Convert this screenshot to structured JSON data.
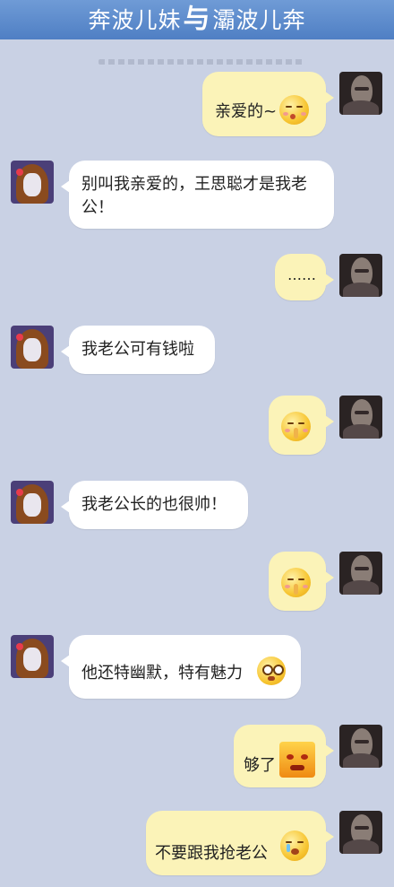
{
  "header": {
    "left": "奔波儿妹",
    "separator": "与",
    "right": "灞波儿奔"
  },
  "messages": [
    {
      "text": "亲爱的~",
      "icon": "kiss-emoji-icon"
    },
    {
      "text": "别叫我亲爱的，王思聪才是我老公！"
    },
    {
      "text": "……"
    },
    {
      "text": "我老公可有钱啦"
    },
    {
      "text": "",
      "icon": "shush-emoji-icon"
    },
    {
      "text": "我老公长的也很帅！"
    },
    {
      "text": "",
      "icon": "shush-emoji-icon"
    },
    {
      "text": "他还特幽默，特有魅力",
      "icon": "teary-eyed-emoji-icon"
    },
    {
      "text": "够了",
      "icon": "angry-emoji-icon"
    },
    {
      "text": "不要跟我抢老公",
      "icon": "crying-emoji-icon"
    }
  ]
}
